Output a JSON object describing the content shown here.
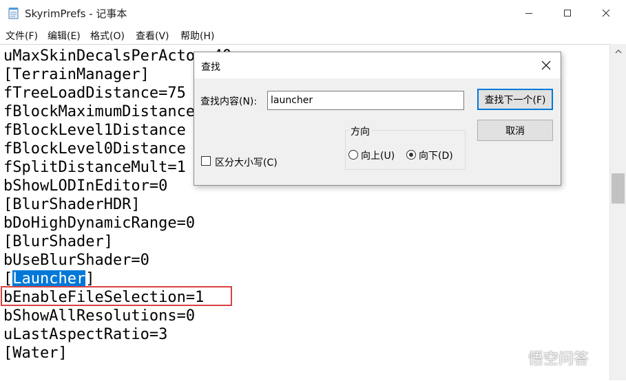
{
  "window": {
    "title": "SkyrimPrefs - 记事本"
  },
  "menu": [
    "文件(F)",
    "编辑(E)",
    "格式(O)",
    "查看(V)",
    "帮助(H)"
  ],
  "editor": {
    "lines": [
      "uMaxSkinDecalsPerActor=40",
      "[TerrainManager]",
      "fTreeLoadDistance=75",
      "fBlockMaximumDistance",
      "fBlockLevel1Distance",
      "fBlockLevel0Distance",
      "fSplitDistanceMult=1",
      "bShowLODInEditor=0",
      "[BlurShaderHDR]",
      "bDoHighDynamicRange=0",
      "[BlurShader]",
      "bUseBlurShader=0",
      "",
      "bEnableFileSelection=1",
      "bShowAllResolutions=0",
      "uLastAspectRatio=3",
      "[Water]"
    ],
    "launcher_open": "[",
    "launcher_selected": "Launcher",
    "launcher_close": "]"
  },
  "find_dialog": {
    "title": "查找",
    "find_label": "查找内容(N):",
    "find_value": "launcher",
    "find_next_button": "查找下一个(F)",
    "cancel_button": "取消",
    "direction_label": "方向",
    "direction_up": "向上(U)",
    "direction_down": "向下(D)",
    "direction_selected": "down",
    "match_case_label": "区分大小写(C)",
    "match_case_checked": false
  },
  "watermark": {
    "text": "悟空问答"
  }
}
